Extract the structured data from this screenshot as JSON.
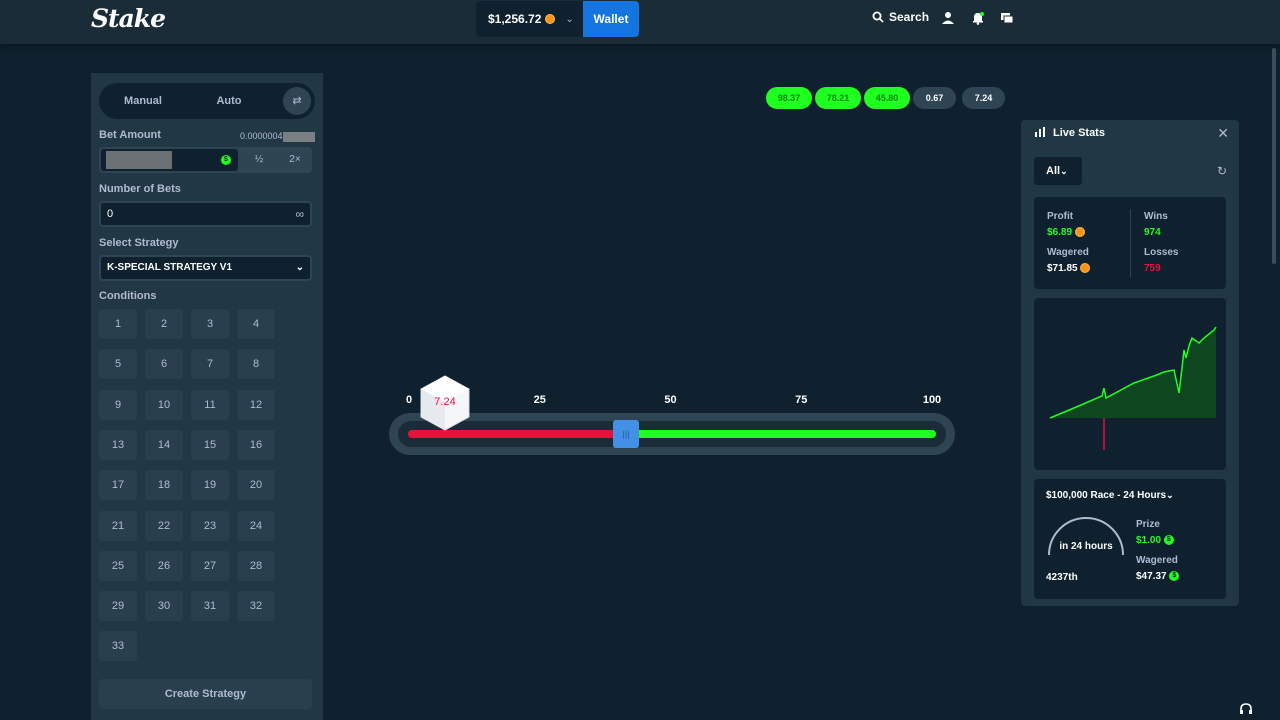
{
  "header": {
    "logo": "Stake",
    "balance": "$1,256.72",
    "wallet_label": "Wallet",
    "search_label": "Search"
  },
  "left_panel": {
    "tabs": [
      "Manual",
      "Auto"
    ],
    "bet_amount_label": "Bet Amount",
    "bet_amount_value": "0.0000004",
    "half_label": "½",
    "double_label": "2×",
    "number_of_bets_label": "Number of Bets",
    "number_of_bets_value": "0",
    "select_strategy_label": "Select Strategy",
    "strategy_value": "K-SPECIAL STRATEGY V1",
    "conditions_label": "Conditions",
    "conditions": [
      "1",
      "2",
      "3",
      "4",
      "5",
      "6",
      "7",
      "8",
      "9",
      "10",
      "11",
      "12",
      "13",
      "14",
      "15",
      "16",
      "17",
      "18",
      "19",
      "20",
      "21",
      "22",
      "23",
      "24",
      "25",
      "26",
      "27",
      "28",
      "29",
      "30",
      "31",
      "32",
      "33"
    ],
    "create_strategy_label": "Create Strategy"
  },
  "game": {
    "recent_results": [
      {
        "value": "98.37",
        "win": true
      },
      {
        "value": "78.21",
        "win": true
      },
      {
        "value": "45.80",
        "win": true
      },
      {
        "value": "0.67",
        "win": false
      },
      {
        "value": "7.24",
        "win": false
      }
    ],
    "ticks": [
      "0",
      "25",
      "50",
      "75",
      "100"
    ],
    "roll_result": "7.24",
    "roll_result_value": 7.24,
    "slider_value": 41.5
  },
  "live_stats": {
    "title": "Live Stats",
    "filter": "All",
    "profit_label": "Profit",
    "profit_value": "$6.89",
    "wagered_label": "Wagered",
    "wagered_value": "$71.85",
    "wins_label": "Wins",
    "wins_value": "974",
    "losses_label": "Losses",
    "losses_value": "759",
    "race_title": "$100,000 Race - 24 Hours",
    "race_timer": "in 24 hours",
    "race_rank": "4237th",
    "prize_label": "Prize",
    "prize_value": "$1.00",
    "race_wagered_label": "Wagered",
    "race_wagered_value": "$47.37"
  },
  "colors": {
    "win": "#1fff20",
    "loss": "#e9113c",
    "accent": "#1475e1"
  }
}
